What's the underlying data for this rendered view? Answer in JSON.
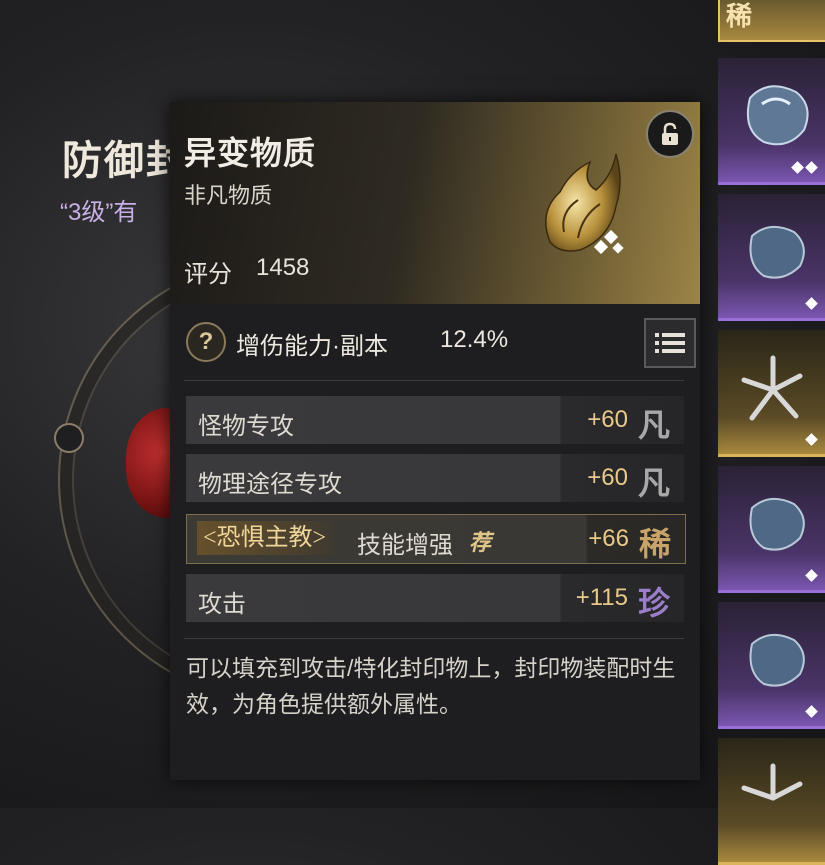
{
  "background": {
    "title": "防御封",
    "subtitle": "“3级”有"
  },
  "tooltip": {
    "name": "异变物质",
    "type": "非凡物质",
    "score_label": "评分",
    "score_value": "1458",
    "main_stat": {
      "name": "增伤能力·副本",
      "value": "12.4%"
    },
    "sub_stats": [
      {
        "name": "怪物专攻",
        "value": "+60",
        "grade": "凡"
      },
      {
        "name": "物理途径专攻",
        "value": "+60",
        "grade": "凡"
      },
      {
        "skill": "<恐惧主教>",
        "name": "技能增强",
        "recommend": "荐",
        "value": "+66",
        "grade": "稀"
      },
      {
        "name": "攻击",
        "value": "+115",
        "grade": "珍"
      }
    ],
    "description": "可以填充到攻击/特化封印物上，封印物装配时生效，为角色提供额外属性。"
  },
  "inventory": {
    "top_slot_label": "稀"
  },
  "colors": {
    "grade_fan": "#a8a8a8",
    "grade_xi": "#c9a46a",
    "grade_zhen": "#9a7ec8",
    "accent_gold": "#e8c98a"
  },
  "icons": {
    "lock": "lock-open-icon",
    "help": "question-icon",
    "list": "list-icon"
  }
}
